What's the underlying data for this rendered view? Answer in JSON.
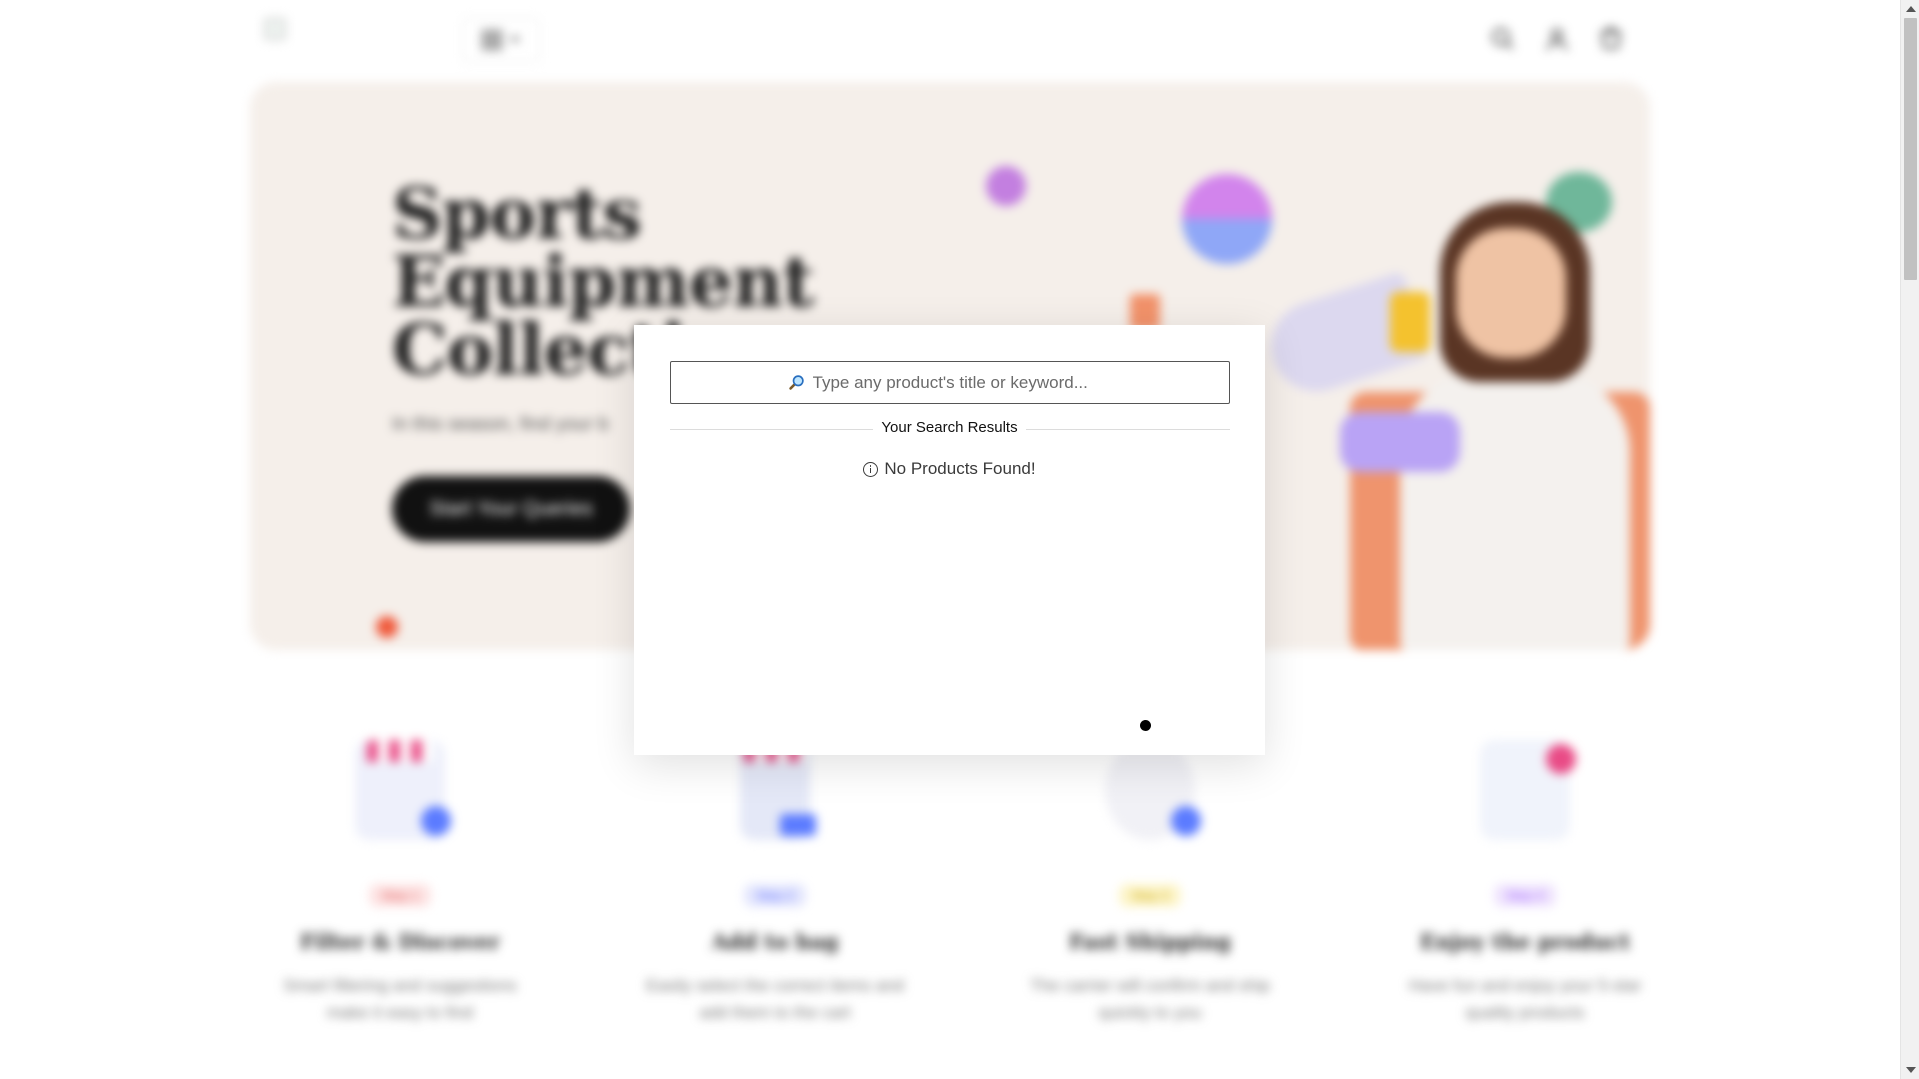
{
  "header": {
    "logo_icon": "broken-image-icon",
    "category_icon": "grid-icon",
    "icons": [
      "search-icon",
      "user-icon",
      "cart-icon"
    ]
  },
  "hero": {
    "title_line1": "Sports",
    "title_line2": "Equipment",
    "title_line3": "Collecti",
    "subtitle": "In this season, find your b",
    "cta_label": "Start Your Queries",
    "accent_color": "#f05a3c",
    "background_color": "#f5efea"
  },
  "steps": [
    {
      "pill": "Step 1",
      "pill_color": "#fde3e3",
      "pill_text_color": "#e05656",
      "title": "Filter & Discover",
      "desc_line1": "Smart filtering and suggestions",
      "desc_line2": "make it easy to find"
    },
    {
      "pill": "Step 2",
      "pill_color": "#e3e6fd",
      "pill_text_color": "#5b6bff",
      "title": "Add to bag",
      "desc_line1": "Easily select the correct items and",
      "desc_line2": "add them to the cart"
    },
    {
      "pill": "Step 3",
      "pill_color": "#fdf5c9",
      "pill_text_color": "#c9a400",
      "title": "Fast Shipping",
      "desc_line1": "The carrier will confirm and ship",
      "desc_line2": "quickly to you"
    },
    {
      "pill": "Step 4",
      "pill_color": "#efe3fd",
      "pill_text_color": "#9a5bff",
      "title": "Enjoy the product",
      "desc_line1": "Have fun and enjoy your 5-star",
      "desc_line2": "quality products"
    }
  ],
  "search_modal": {
    "search_icon": "magnifier-emoji-icon",
    "placeholder": "Type any product's title or keyword...",
    "results_label": "Your Search Results",
    "empty_icon": "info-icon",
    "empty_message": "No Products Found!"
  }
}
